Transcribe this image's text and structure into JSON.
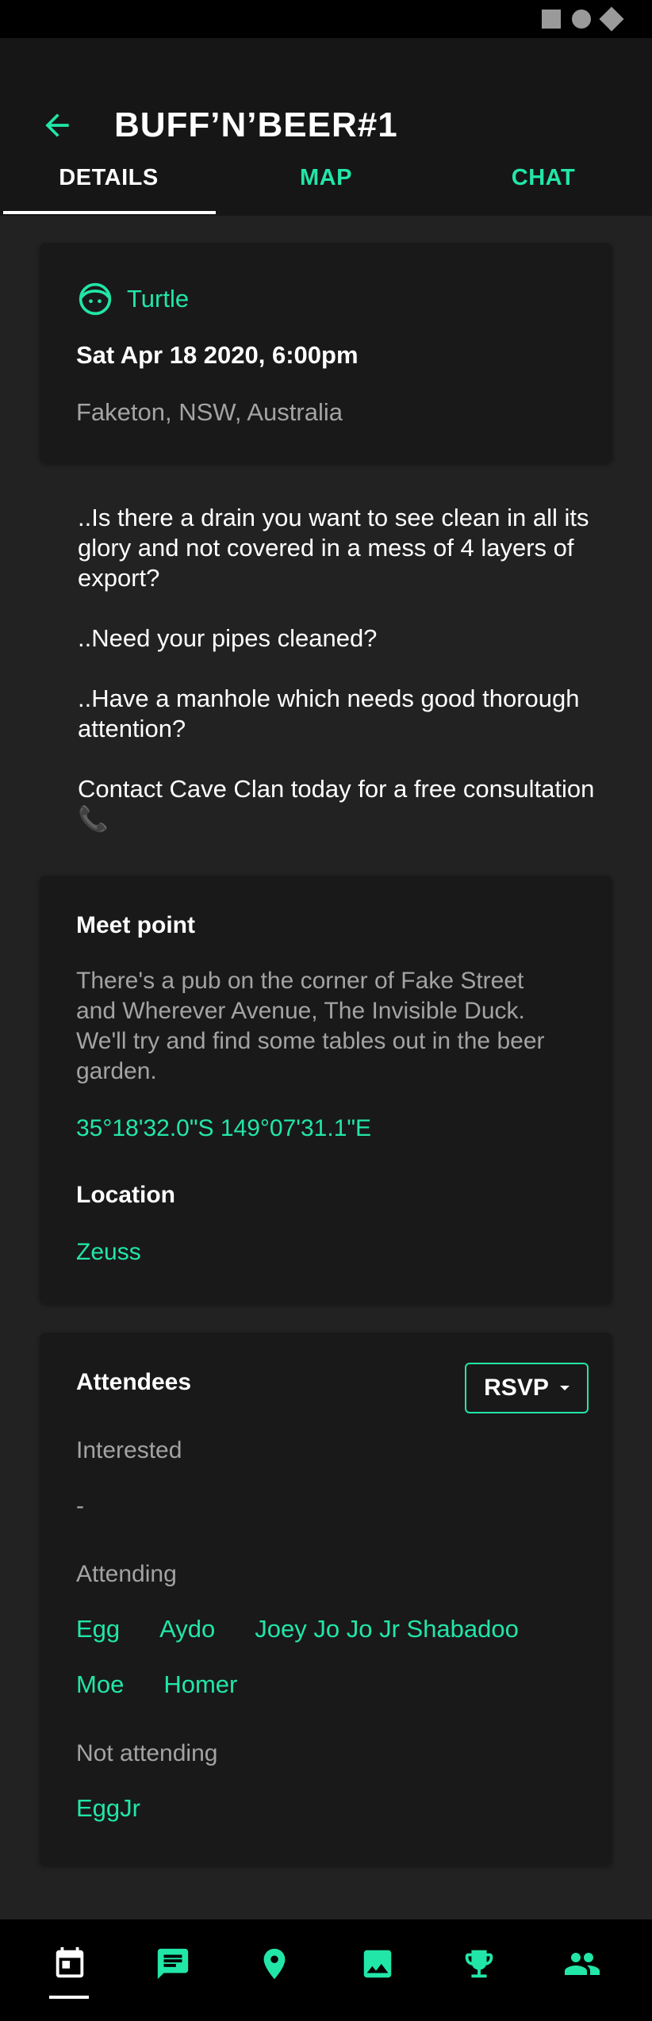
{
  "header": {
    "title": "BUFF’N’BEER#1",
    "back_icon": "arrow-left-icon"
  },
  "tabs": [
    {
      "label": "DETAILS",
      "active": true
    },
    {
      "label": "MAP",
      "active": false
    },
    {
      "label": "CHAT",
      "active": false
    }
  ],
  "event": {
    "host": "Turtle",
    "host_icon": "face-icon",
    "datetime": "Sat Apr 18 2020, 6:00pm",
    "place": "Faketon, NSW, Australia"
  },
  "description": [
    "..Is there a drain you want to see clean in all its glory and not covered in a mess of 4 layers of export?",
    "..Need your pipes cleaned?",
    "..Have a manhole which needs good thorough attention?",
    "Contact Cave Clan today for a free consultation 📞"
  ],
  "meet": {
    "label": "Meet point",
    "text": "There's a pub on the corner of Fake Street and Wherever Avenue, The Invisible Duck. We'll try and find some tables out in the beer garden.",
    "coords": "35°18'32.0\"S 149°07'31.1\"E",
    "location_label": "Location",
    "location_value": "Zeuss"
  },
  "attendees": {
    "label": "Attendees",
    "rsvp_label": "RSVP",
    "interested_label": "Interested",
    "interested_empty": "-",
    "attending_label": "Attending",
    "attending": [
      "Egg",
      "Aydo",
      "Joey Jo Jo Jr Shabadoo",
      "Moe",
      "Homer"
    ],
    "not_attending_label": "Not attending",
    "not_attending": [
      "EggJr"
    ]
  },
  "bottom_nav": [
    {
      "icon": "calendar-icon",
      "active": true
    },
    {
      "icon": "chat-icon",
      "active": false
    },
    {
      "icon": "location-pin-icon",
      "active": false
    },
    {
      "icon": "image-icon",
      "active": false
    },
    {
      "icon": "trophy-icon",
      "active": false
    },
    {
      "icon": "people-icon",
      "active": false
    }
  ],
  "colors": {
    "accent": "#22e6a8",
    "background": "#222222",
    "card": "#191919",
    "app_bar": "#161616"
  }
}
